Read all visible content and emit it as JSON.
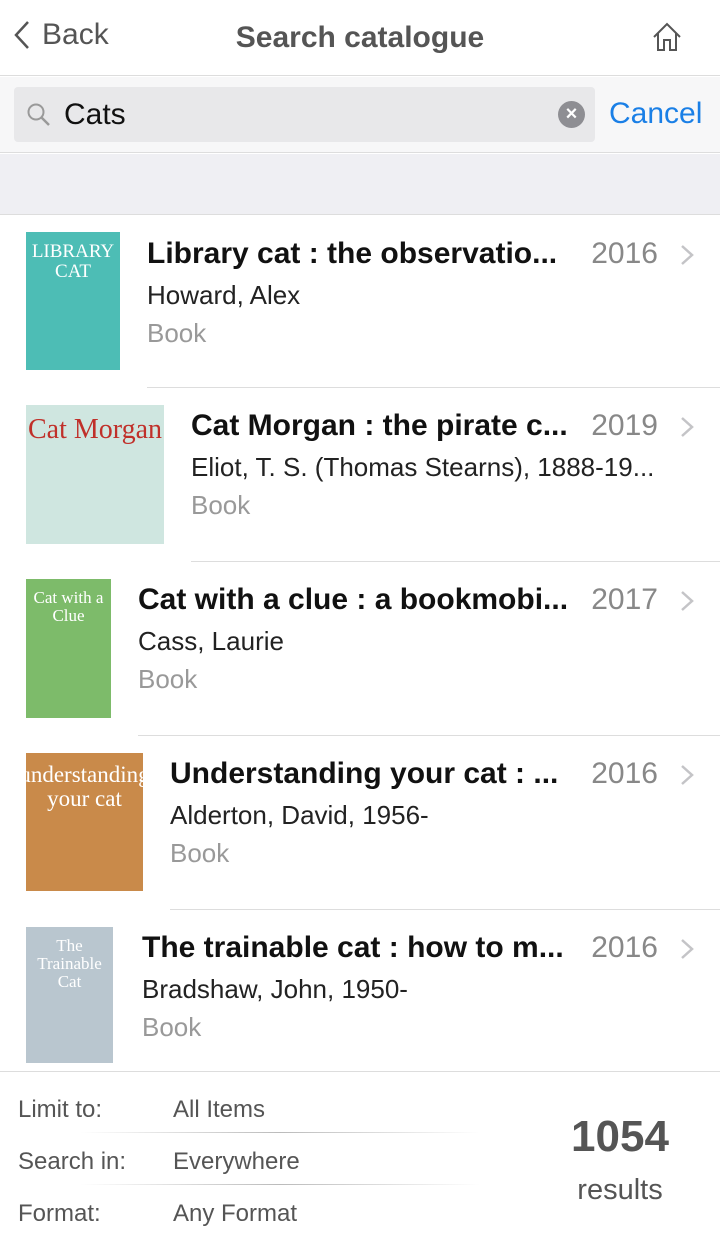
{
  "nav": {
    "back_label": "Back",
    "title": "Search catalogue"
  },
  "search": {
    "value": "Cats",
    "cancel_label": "Cancel"
  },
  "results": [
    {
      "title": "Library cat : the observatio...",
      "year": "2016",
      "author": "Howard, Alex",
      "format": "Book",
      "cover_text": "LIBRARY CAT",
      "cover_color": "#4dbdb5"
    },
    {
      "title": "Cat Morgan : the pirate c...",
      "year": "2019",
      "author": "Eliot, T. S. (Thomas Stearns), 1888-19...",
      "format": "Book",
      "cover_text": "Cat Morgan",
      "cover_color": "#cfe6e0"
    },
    {
      "title": "Cat with a clue : a bookmobi...",
      "year": "2017",
      "author": "Cass, Laurie",
      "format": "Book",
      "cover_text": "Cat with a Clue",
      "cover_color": "#7dbb6a"
    },
    {
      "title": "Understanding your cat : ...",
      "year": "2016",
      "author": "Alderton, David, 1956-",
      "format": "Book",
      "cover_text": "understanding your cat",
      "cover_color": "#c98a4a"
    },
    {
      "title": "The trainable cat : how to m...",
      "year": "2016",
      "author": "Bradshaw, John, 1950-",
      "format": "Book",
      "cover_text": "The Trainable Cat",
      "cover_color": "#b9c6cf"
    }
  ],
  "footer": {
    "limit_label": "Limit to:",
    "limit_value": "All Items",
    "search_in_label": "Search in:",
    "search_in_value": "Everywhere",
    "format_label": "Format:",
    "format_value": "Any Format",
    "count": "1054",
    "count_label": "results"
  }
}
